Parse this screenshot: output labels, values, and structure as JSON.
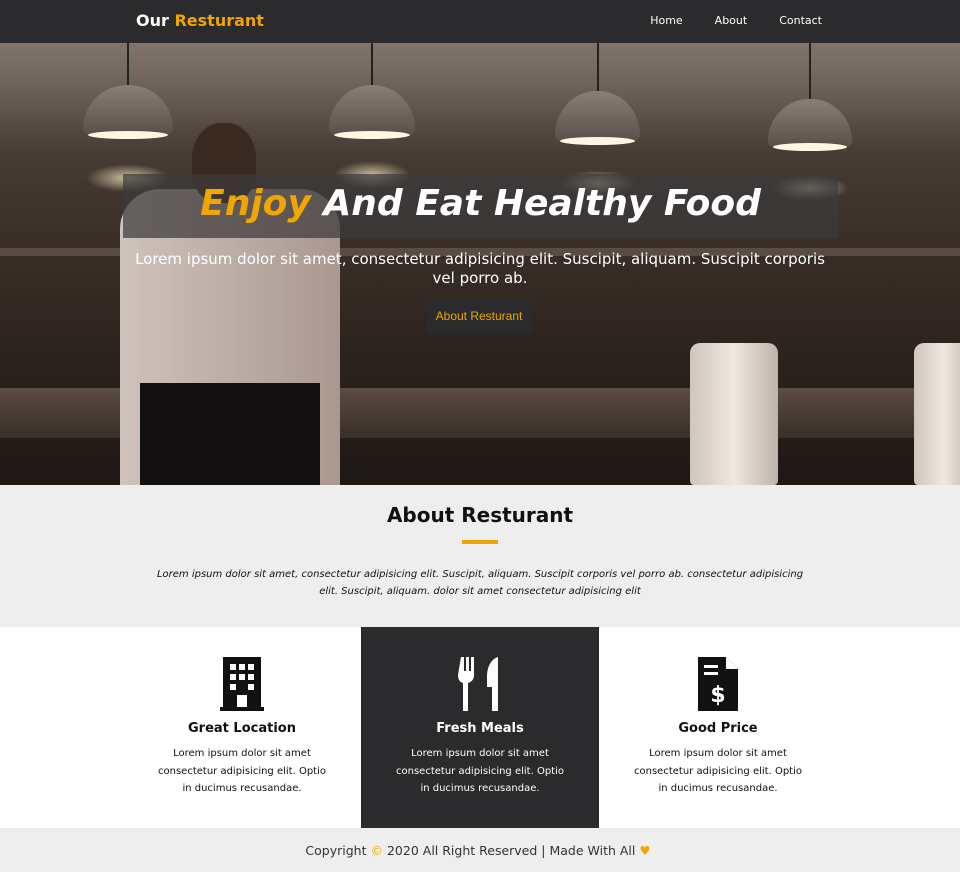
{
  "nav": {
    "brand_prefix": "Our",
    "brand_accent": "Resturant",
    "links": [
      "Home",
      "About",
      "Contact"
    ]
  },
  "hero": {
    "title_accent": "Enjoy",
    "title_rest": "And Eat Healthy Food",
    "subtitle": "Lorem ipsum dolor sit amet, consectetur adipisicing elit. Suscipit, aliquam. Suscipit corporis vel porro ab.",
    "button_label": "About Resturant"
  },
  "about": {
    "title": "About Resturant",
    "text": "Lorem ipsum dolor sit amet, consectetur adipisicing elit. Suscipit, aliquam. Suscipit corporis vel porro ab. consectetur adipisicing elit. Suscipit, aliquam. dolor sit amet consectetur adipisicing elit"
  },
  "features": [
    {
      "icon": "building-icon",
      "title": "Great Location",
      "text": "Lorem ipsum dolor sit amet consectetur adipisicing elit. Optio in ducimus recusandae."
    },
    {
      "icon": "utensils-icon",
      "title": "Fresh Meals",
      "text": "Lorem ipsum dolor sit amet consectetur adipisicing elit. Optio in ducimus recusandae."
    },
    {
      "icon": "invoice-dollar-icon",
      "title": "Good Price",
      "text": "Lorem ipsum dolor sit amet consectetur adipisicing elit. Optio in ducimus recusandae."
    }
  ],
  "footer": {
    "copyright_word": "Copyright",
    "copyright_symbol": "©",
    "text": "2020 All Right Reserved | Made With All",
    "heart": "♥"
  },
  "colors": {
    "accent": "#f0a500",
    "dark": "#2b2a2c",
    "light_bg": "#efeeef"
  }
}
